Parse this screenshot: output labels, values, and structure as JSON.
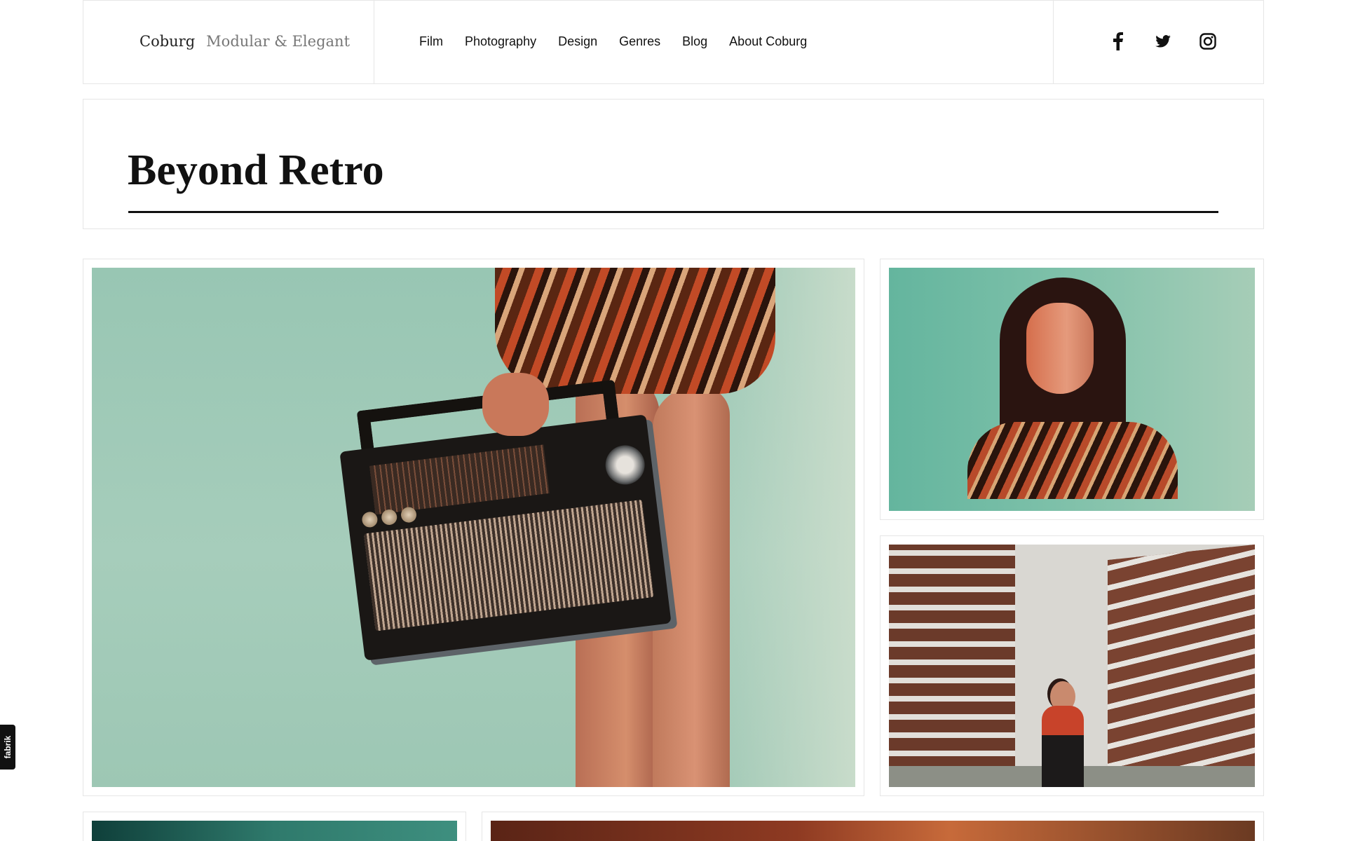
{
  "brand": {
    "name": "Coburg",
    "tagline": "Modular & Elegant"
  },
  "nav": {
    "items": [
      {
        "label": "Film"
      },
      {
        "label": "Photography"
      },
      {
        "label": "Design"
      },
      {
        "label": "Genres"
      },
      {
        "label": "Blog"
      },
      {
        "label": "About Coburg"
      }
    ]
  },
  "social": {
    "icons": [
      "facebook-icon",
      "twitter-icon",
      "instagram-icon"
    ]
  },
  "page": {
    "title": "Beyond Retro"
  },
  "floating_tab": {
    "label": "fabrik"
  },
  "colors": {
    "text": "#111111",
    "muted": "#777777",
    "border": "#e6e6e6",
    "background": "#ffffff"
  }
}
